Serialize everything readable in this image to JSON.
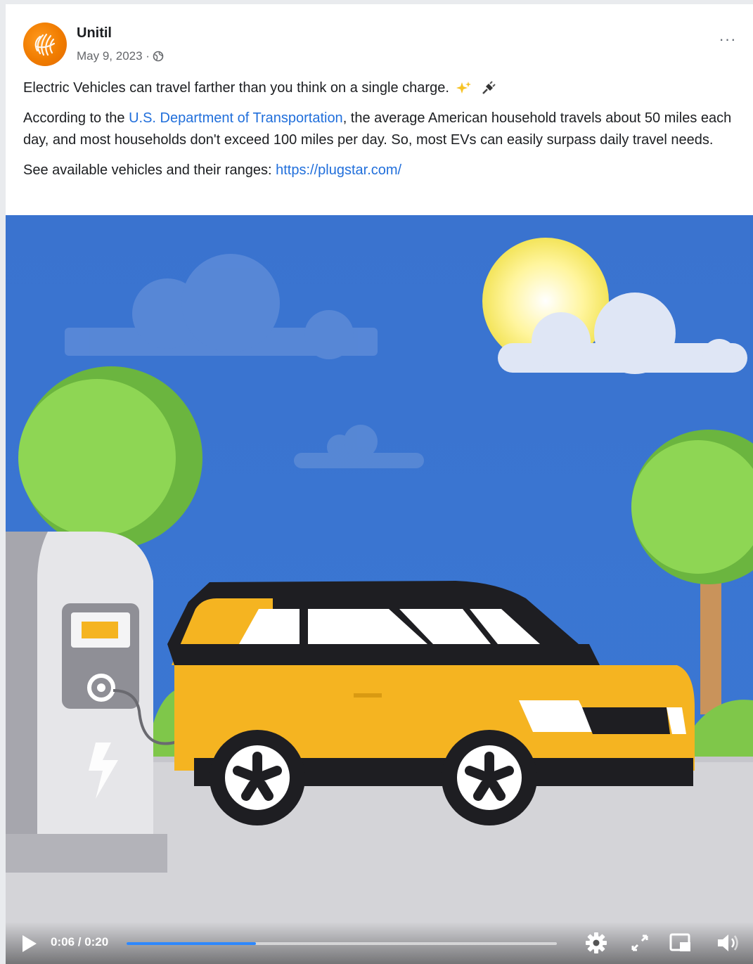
{
  "post": {
    "page_name": "Unitil",
    "date": "May 9, 2023 ·",
    "more_label": "···",
    "line1": "Electric Vehicles can travel farther than you think on a single charge.",
    "para2_before": "According to the ",
    "para2_link": "U.S. Department of Transportation",
    "para2_after": ", the average American household travels about 50 miles each day, and most households don't exceed 100 miles per day. So, most EVs can easily surpass daily travel needs.",
    "para3_before": "See available vehicles and their ranges: ",
    "para3_link": "https://plugstar.com/"
  },
  "video": {
    "time": "0:06 / 0:20",
    "progress_fraction": 0.3,
    "illustration_icons": [
      "sun-icon",
      "cloud-icon",
      "tree-icon",
      "charging-station-icon",
      "car-icon"
    ]
  },
  "icons": {
    "avatar": "unitil-logo-icon",
    "privacy": "globe-icon",
    "emoji1": "sparkles-icon",
    "emoji2": "electric-plug-icon",
    "play": "play-icon",
    "settings": "gear-icon",
    "fullscreen": "expand-icon",
    "pip": "picture-in-picture-icon",
    "volume": "speaker-icon"
  },
  "colors": {
    "link": "#216fdb",
    "sky": "#3b74d0",
    "car": "#f5b421",
    "progress": "#2d88ff"
  }
}
